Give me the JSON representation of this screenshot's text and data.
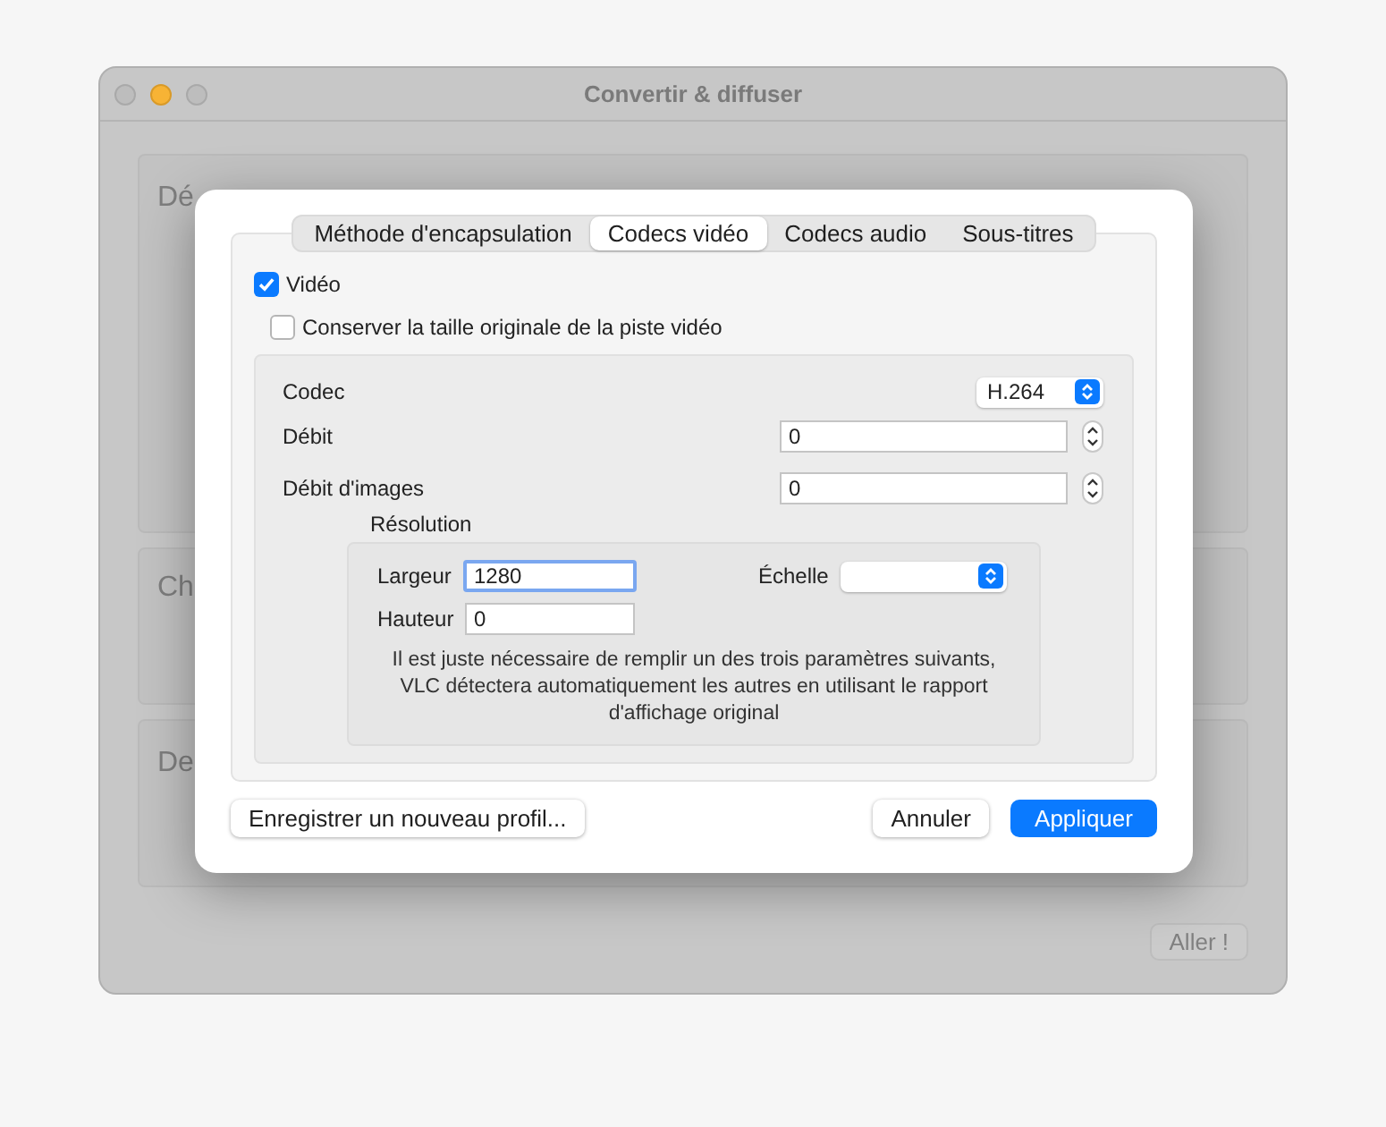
{
  "window": {
    "title": "Convertir & diffuser"
  },
  "background_panels": [
    {
      "heading": "Dé"
    },
    {
      "heading": "Ch"
    },
    {
      "heading": "De"
    }
  ],
  "go_button": {
    "label": "Aller !",
    "disabled": true
  },
  "dialog": {
    "tabs": [
      {
        "label": "Méthode d'encapsulation",
        "selected": false
      },
      {
        "label": "Codecs vidéo",
        "selected": true
      },
      {
        "label": "Codecs audio",
        "selected": false
      },
      {
        "label": "Sous-titres",
        "selected": false
      }
    ],
    "video_checkbox": {
      "label": "Vidéo",
      "checked": true
    },
    "keep_size_checkbox": {
      "label": "Conserver la taille originale de la piste vidéo",
      "checked": false
    },
    "codec": {
      "label": "Codec",
      "value": "H.264"
    },
    "bitrate": {
      "label": "Débit",
      "value": "0"
    },
    "framerate": {
      "label": "Débit d'images",
      "value": "0"
    },
    "resolution": {
      "label": "Résolution",
      "width": {
        "label": "Largeur",
        "value": "1280",
        "focused": true
      },
      "height": {
        "label": "Hauteur",
        "value": "0",
        "focused": false
      },
      "scale": {
        "label": "Échelle"
      },
      "note": "Il est juste nécessaire de remplir un des trois paramètres suivants, VLC détectera automatiquement les autres en utilisant le rapport d'affichage original"
    },
    "buttons": [
      {
        "label": "Enregistrer un nouveau profil...",
        "kind": "default"
      },
      {
        "label": "Annuler",
        "kind": "default"
      },
      {
        "label": "Appliquer",
        "kind": "primary"
      }
    ]
  }
}
